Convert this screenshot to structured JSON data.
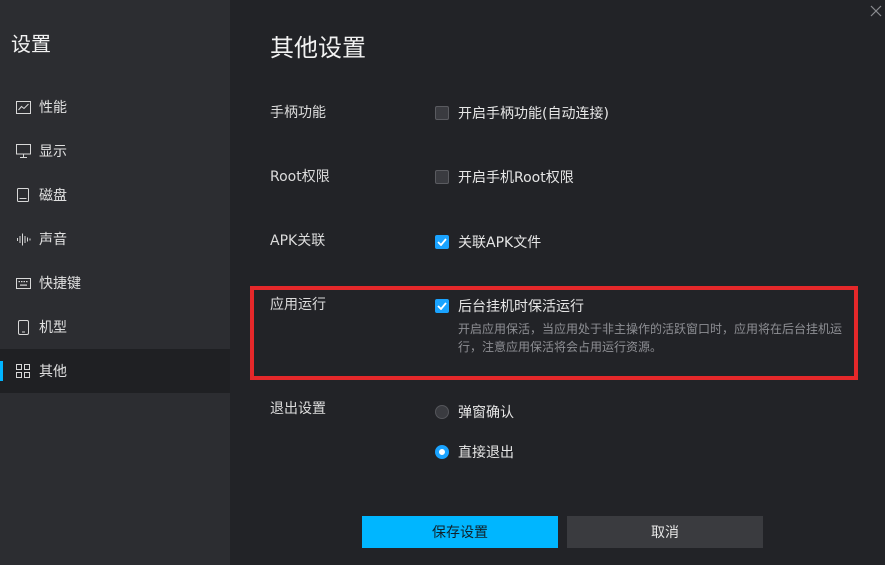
{
  "sidebar": {
    "title": "设置",
    "items": [
      {
        "label": "性能",
        "icon": "chart-icon",
        "active": false
      },
      {
        "label": "显示",
        "icon": "monitor-icon",
        "active": false
      },
      {
        "label": "磁盘",
        "icon": "disk-icon",
        "active": false
      },
      {
        "label": "声音",
        "icon": "sound-wave-icon",
        "active": false
      },
      {
        "label": "快捷键",
        "icon": "keyboard-icon",
        "active": false
      },
      {
        "label": "机型",
        "icon": "phone-icon",
        "active": false
      },
      {
        "label": "其他",
        "icon": "grid-icon",
        "active": true
      }
    ]
  },
  "main": {
    "title": "其他设置",
    "gamepad": {
      "label": "手柄功能",
      "option": "开启手柄功能(自动连接)",
      "checked": false
    },
    "root": {
      "label": "Root权限",
      "option": "开启手机Root权限",
      "checked": false
    },
    "apk": {
      "label": "APK关联",
      "option": "关联APK文件",
      "checked": true
    },
    "app_run": {
      "label": "应用运行",
      "option": "后台挂机时保活运行",
      "checked": true,
      "description": "开启应用保活，当应用处于非主操作的活跃窗口时，应用将在后台挂机运行，注意应用保活将会占用运行资源。"
    },
    "exit": {
      "label": "退出设置",
      "options": [
        {
          "label": "弹窗确认",
          "selected": false
        },
        {
          "label": "直接退出",
          "selected": true
        }
      ]
    },
    "buttons": {
      "save": "保存设置",
      "cancel": "取消"
    }
  },
  "colors": {
    "accent": "#00b6ff",
    "highlight_border": "#e5282a",
    "sidebar_bg": "#2c2d31",
    "main_bg": "#222327"
  }
}
